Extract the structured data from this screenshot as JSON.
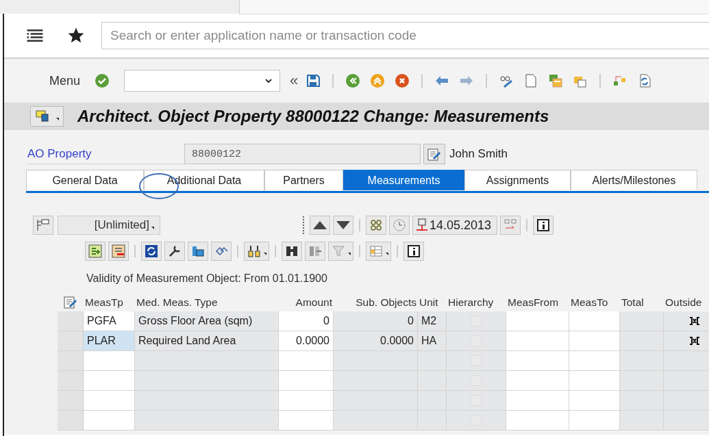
{
  "shell": {
    "search": {
      "placeholder": "Search or enter application name or transaction code"
    }
  },
  "toolbar": {
    "menu_label": "Menu",
    "collapse_label": "«"
  },
  "title_bar": {
    "title": "Architect. Object Property 88000122 Change: Measurements"
  },
  "header_fields": {
    "label": "AO Property",
    "value": "88000122",
    "owner": "John Smith"
  },
  "tabs": [
    {
      "label": "General Data",
      "selected": false
    },
    {
      "label": "Additional Data",
      "selected": false
    },
    {
      "label": "Partners",
      "selected": false
    },
    {
      "label": "Measurements",
      "selected": true
    },
    {
      "label": "Assignments",
      "selected": false
    },
    {
      "label": "Alerts/Milestones",
      "selected": false
    }
  ],
  "measurements": {
    "validity_dropdown": "[Unlimited]",
    "key_date": "14.05.2013",
    "validity_text": "Validity of Measurement Object: From 01.01.1900",
    "table": {
      "columns": [
        {
          "label": "MeasTp",
          "kind": "text"
        },
        {
          "label": "Med. Meas. Type",
          "kind": "text"
        },
        {
          "label": "Amount",
          "kind": "number"
        },
        {
          "label": "Sub. Objects",
          "kind": "number"
        },
        {
          "label": "Unit",
          "kind": "text"
        },
        {
          "label": "Hierarchy",
          "kind": "check"
        },
        {
          "label": "MeasFrom",
          "kind": "blank"
        },
        {
          "label": "MeasTo",
          "kind": "blank"
        },
        {
          "label": "Total",
          "kind": "blank"
        },
        {
          "label": "Outside",
          "kind": "interval"
        }
      ],
      "rows": [
        {
          "cells": [
            "PGFA",
            "Gross Floor Area (sqm)",
            "0",
            "0",
            "M2"
          ],
          "hierarchy_checked": false,
          "selected": false
        },
        {
          "cells": [
            "PLAR",
            "Required Land Area",
            "0.0000",
            "0.0000",
            "HA"
          ],
          "hierarchy_checked": false,
          "selected": true
        },
        {
          "hierarchy_checked": false,
          "selected": false
        },
        {
          "hierarchy_checked": false,
          "selected": false
        },
        {
          "hierarchy_checked": false,
          "selected": false
        },
        {
          "hierarchy_checked": false,
          "selected": false
        }
      ]
    }
  }
}
